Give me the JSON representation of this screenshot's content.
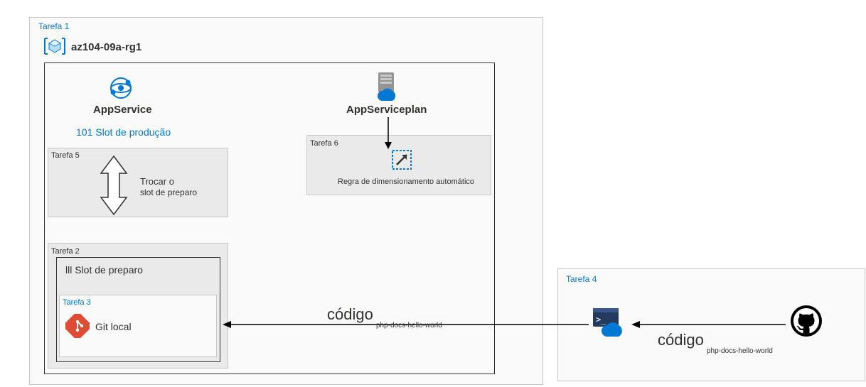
{
  "task1": {
    "label": "Tarefa 1",
    "rg_title": "az104-09a-rg1"
  },
  "appservice": {
    "title": "AppService",
    "slot_prod": "101 Slot de produção"
  },
  "task5": {
    "label": "Tarefa 5",
    "swap_line1": "Trocar o",
    "swap_line2": "slot de preparo"
  },
  "task2": {
    "label": "Tarefa 2",
    "slot_staging": "lll Slot de preparo"
  },
  "task3": {
    "label": "Tarefa 3",
    "git_label": "Git local"
  },
  "asp": {
    "title": "AppServiceplan"
  },
  "task6": {
    "label": "Tarefa 6",
    "rule_label": "Regra de dimensionamento automático"
  },
  "code": {
    "label": "código",
    "repo": "php-docs-hello-world"
  },
  "task4": {
    "label": "Tarefa 4"
  }
}
